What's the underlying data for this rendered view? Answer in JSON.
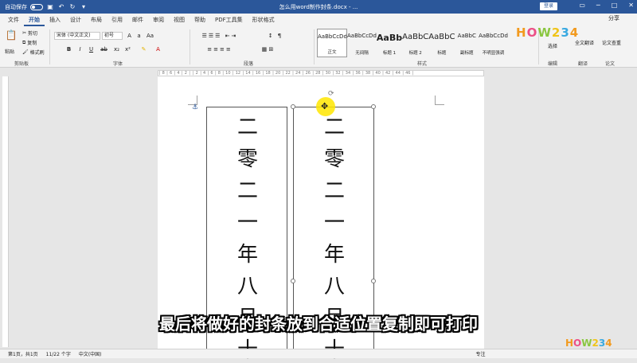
{
  "titlebar": {
    "autosave_label": "自动保存",
    "autosave_state": "关",
    "doc_title": "怎么用word制作封条.docx - ...",
    "search_placeholder": "",
    "login_label": "登录"
  },
  "tabs": [
    "文件",
    "开始",
    "插入",
    "设计",
    "布局",
    "引用",
    "邮件",
    "审阅",
    "视图",
    "帮助",
    "PDF工具集",
    "形状格式"
  ],
  "active_tab": "开始",
  "clipboard": {
    "paste_label": "粘贴",
    "cut_label": "剪切",
    "copy_label": "复制",
    "painter_label": "格式刷",
    "group_label": "剪贴板"
  },
  "font": {
    "family_value": "宋体 (中文正文)",
    "size_value": "初号",
    "group_label": "字体",
    "bold": "B",
    "italic": "I",
    "underline": "U"
  },
  "paragraph": {
    "group_label": "段落"
  },
  "styles": {
    "group_label": "样式",
    "items": [
      {
        "sample": "AaBbCcDd",
        "name": "正文",
        "selected": true
      },
      {
        "sample": "AaBbCcDd",
        "name": "无间隔",
        "selected": false
      },
      {
        "sample": "AaBb",
        "name": "标题 1",
        "selected": false
      },
      {
        "sample": "AaBbC",
        "name": "标题 2",
        "selected": false
      },
      {
        "sample": "AaBbC",
        "name": "标题",
        "selected": false
      },
      {
        "sample": "AaBbC",
        "name": "副标题",
        "selected": false
      },
      {
        "sample": "AaBbCcDd",
        "name": "不明显强调",
        "selected": false
      }
    ]
  },
  "editing": {
    "select_label": "选择",
    "group_label": "编辑"
  },
  "translate": {
    "label": "全文翻译",
    "group_label": "翻译"
  },
  "paper": {
    "label": "论文查重",
    "group_label": "论文"
  },
  "watermark": "HOW234",
  "document": {
    "strip_chars": [
      "二",
      "零",
      "二",
      "一",
      "年",
      "八",
      "月",
      "十"
    ]
  },
  "subtitle": "最后将做好的封条放到合适位置复制即可打印",
  "status": {
    "page": "第1页，共1页",
    "words": "11/22 个字",
    "lang": "中文(中国)",
    "focus": "专注"
  }
}
